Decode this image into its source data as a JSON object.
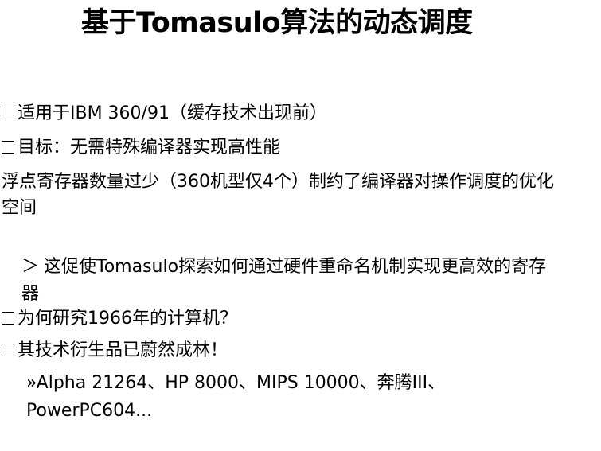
{
  "title": "基于Tomasulo算法的动态调度",
  "items": {
    "i1": "适用于IBM 360/91（缓存技术出现前）",
    "i2": "目标：无需特殊编译器实现高性能",
    "p1": "浮点寄存器数量过少（360机型仅4个）制约了编译器对操作调度的优化空间",
    "s1_marker": "＞",
    "s1": "这促使Tomasulo探索如何通过硬件重命名机制实现更高效的寄存器",
    "i3": "为何研究1966年的计算机？",
    "i4": "其技术衍生品已蔚然成林！",
    "ss1": "»Alpha 21264、HP 8000、MIPS 10000、奔腾III、PowerPC604..."
  }
}
